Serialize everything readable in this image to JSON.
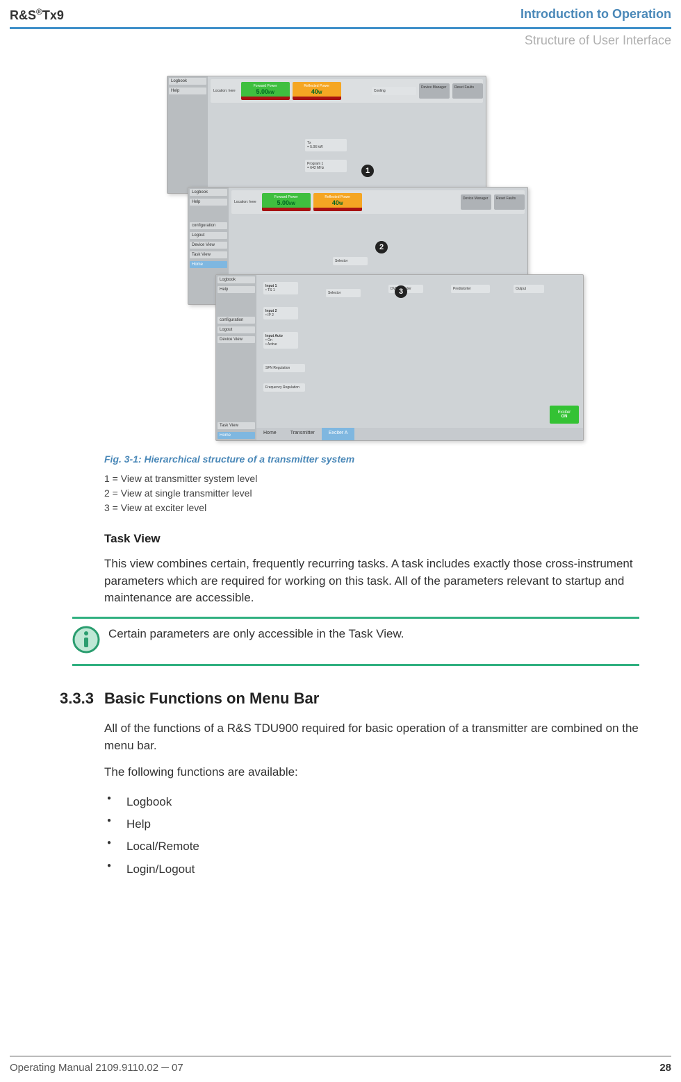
{
  "header": {
    "product_prefix": "R&S",
    "product_reg": "®",
    "product_suffix": "Tx9",
    "chapter": "Introduction to Operation",
    "subhead": "Structure of User Interface"
  },
  "figure": {
    "caption": "Fig. 3-1: Hierarchical structure of a transmitter system",
    "legend": [
      "1 = View at transmitter system level",
      "2 = View at single transmitter level",
      "3 = View at exciter level"
    ],
    "ui": {
      "location_label": "Location: here",
      "fwd_label": "Forward Power",
      "fwd_value": "5.00",
      "fwd_unit": "kW",
      "ref_label": "Reflected Power",
      "ref_value": "40",
      "ref_unit": "W",
      "sidebar": [
        "Logbook",
        "Help",
        "configuration",
        "Logout",
        "Device View",
        "Task View",
        "Home"
      ],
      "btn_device": "Device Manager",
      "btn_reset": "Reset Faults",
      "tx_small": "= 5.06 kW",
      "program": "Program 1",
      "freq": "= 642 MHz",
      "selector": "Selector",
      "input1": "Input 1",
      "input1_sub": "• TS 1",
      "input2": "Input 2",
      "input2_sub": "• IP 2",
      "input_auto": "Input Auto",
      "input_auto_sub1": "• On",
      "input_auto_sub2": "• Active",
      "coder": "DVB-T Coder",
      "predist": "Predistorter",
      "output": "Output",
      "sfn": "SFN Regulation",
      "freqreg": "Frequency Regulation",
      "exciter_label": "Exciter",
      "on_label": "ON",
      "bottom_home": "Home",
      "bottom_tx": "Transmitter",
      "bottom_ex": "Exciter A",
      "cooling": "Cooling"
    }
  },
  "task_view": {
    "heading": "Task View",
    "para": "This view combines certain, frequently recurring tasks. A task includes exactly those cross‑instrument parameters which are required for working on this task. All of the parameters relevant to startup and maintenance are accessible."
  },
  "note": {
    "text": "Certain parameters are only accessible in the Task View."
  },
  "section": {
    "number": "3.3.3",
    "title": "Basic Functions on Menu Bar",
    "para1": "All of the functions of a R&S TDU900 required for basic operation of a transmitter are combined on the menu bar.",
    "para2": "The following functions are available:",
    "bullets": [
      "Logbook",
      "Help",
      "Local/Remote",
      "Login/Logout"
    ]
  },
  "footer": {
    "left": "Operating Manual 2109.9110.02 ─ 07",
    "page": "28"
  }
}
